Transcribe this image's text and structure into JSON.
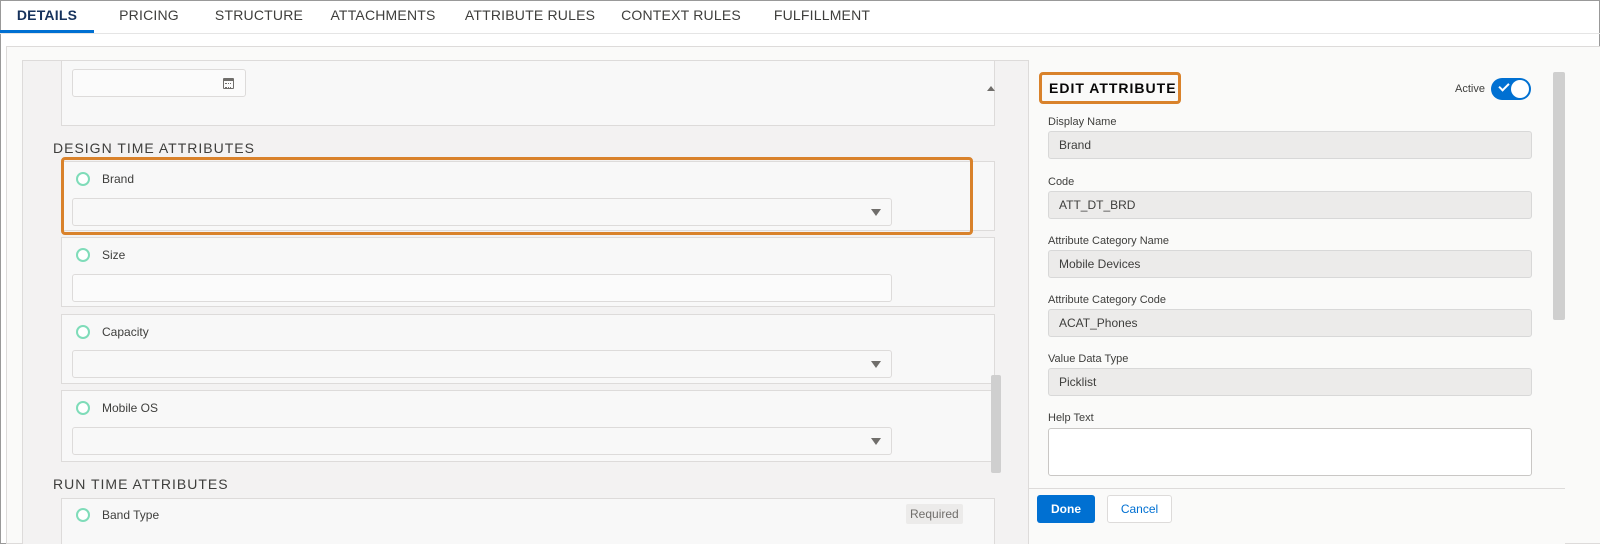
{
  "tabs": [
    {
      "label": "DETAILS",
      "active": true
    },
    {
      "label": "PRICING",
      "active": false
    },
    {
      "label": "STRUCTURE",
      "active": false
    },
    {
      "label": "ATTACHMENTS",
      "active": false
    },
    {
      "label": "ATTRIBUTE RULES",
      "active": false
    },
    {
      "label": "CONTEXT RULES",
      "active": false
    },
    {
      "label": "FULFILLMENT",
      "active": false
    }
  ],
  "left": {
    "design_time_title": "DESIGN TIME ATTRIBUTES",
    "run_time_title": "RUN TIME ATTRIBUTES",
    "design_attributes": [
      {
        "label": "Brand",
        "type": "picklist",
        "value": ""
      },
      {
        "label": "Size",
        "type": "text",
        "value": ""
      },
      {
        "label": "Capacity",
        "type": "picklist",
        "value": ""
      },
      {
        "label": "Mobile OS",
        "type": "picklist",
        "value": ""
      }
    ],
    "run_attributes": [
      {
        "label": "Band Type",
        "badge": "Required"
      }
    ]
  },
  "panel": {
    "title": "EDIT ATTRIBUTE",
    "active_label": "Active",
    "active": true,
    "fields": [
      {
        "label": "Display Name",
        "value": "Brand"
      },
      {
        "label": "Code",
        "value": "ATT_DT_BRD"
      },
      {
        "label": "Attribute Category Name",
        "value": "Mobile Devices"
      },
      {
        "label": "Attribute Category Code",
        "value": "ACAT_Phones"
      },
      {
        "label": "Value Data Type",
        "value": "Picklist"
      }
    ],
    "help_text_label": "Help Text",
    "help_text_value": "",
    "done_label": "Done",
    "cancel_label": "Cancel"
  },
  "colors": {
    "accent": "#0070d2",
    "highlight": "#d9822b",
    "radio": "#7fdcb9"
  }
}
